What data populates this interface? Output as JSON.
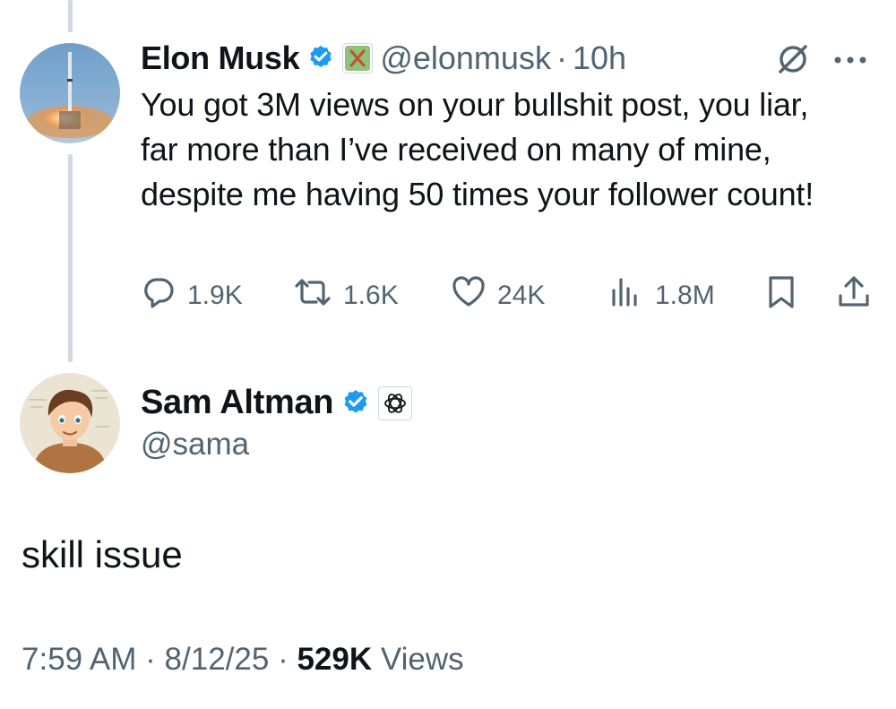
{
  "colors": {
    "text": "#0f1419",
    "secondary": "#536471",
    "verified": "#1d9bf0",
    "thread_line": "#cfd9de"
  },
  "parent": {
    "display_name": "Elon Musk",
    "handle": "@elonmusk",
    "separator": "·",
    "time": "10h",
    "text": "You got 3M views on your bullshit post, you liar, far more than I’ve received on many of mine, despite me having 50 times your follower count!",
    "stats": {
      "replies": "1.9K",
      "reposts": "1.6K",
      "likes": "24K",
      "views": "1.8M"
    },
    "icons": [
      "verified-badge-icon",
      "x-affiliation-icon",
      "grok-icon",
      "more-icon",
      "reply-icon",
      "repost-icon",
      "like-icon",
      "views-icon",
      "bookmark-icon",
      "share-icon"
    ]
  },
  "reply": {
    "display_name": "Sam Altman",
    "handle": "@sama",
    "text": "skill issue",
    "time": "7:59 AM",
    "date": "8/12/25",
    "separator": "·",
    "views_count": "529K",
    "views_label": "Views",
    "icons": [
      "verified-badge-icon",
      "openai-affiliation-icon"
    ]
  }
}
